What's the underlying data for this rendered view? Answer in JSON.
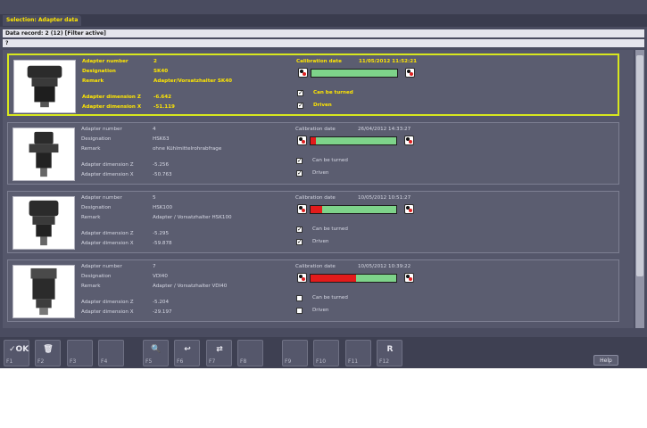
{
  "header": {
    "tab_label": "Selection: Adapter data",
    "record_info": "Data record: 2 (12) [Filter active]",
    "filter_text": "?"
  },
  "labels": {
    "adapter_number": "Adapter number",
    "designation": "Designation",
    "remark": "Remark",
    "dim_z": "Adapter dimension Z",
    "dim_x": "Adapter dimension X",
    "calibration_date": "Calibration date",
    "can_be_turned": "Can be turned",
    "driven": "Driven"
  },
  "records": [
    {
      "number": "2",
      "designation": "SK40",
      "remark": "Adapter/Vorsatzhalter SK40",
      "dim_z": "-6.642",
      "dim_x": "-51.119",
      "calibration_date": "11/05/2012 11:52:21",
      "wear_fraction": 0.0,
      "can_be_turned": true,
      "driven": true,
      "selected": true
    },
    {
      "number": "4",
      "designation": "HSK63",
      "remark": "ohne Kühlmittelrohrabfrage",
      "dim_z": "-5.256",
      "dim_x": "-50.763",
      "calibration_date": "26/04/2012 14:33:27",
      "wear_fraction": 0.06,
      "can_be_turned": true,
      "driven": true,
      "selected": false
    },
    {
      "number": "5",
      "designation": "HSK100",
      "remark": "Adapter / Vorsatzhalter HSK100",
      "dim_z": "-5.295",
      "dim_x": "-59.878",
      "calibration_date": "10/05/2012 10:51:27",
      "wear_fraction": 0.14,
      "can_be_turned": true,
      "driven": true,
      "selected": false
    },
    {
      "number": "7",
      "designation": "VDI40",
      "remark": "Adapter / Vorsatzhalter VDI40",
      "dim_z": "-5.204",
      "dim_x": "-29.197",
      "calibration_date": "10/05/2012 10:39:22",
      "wear_fraction": 0.53,
      "can_be_turned": false,
      "driven": false,
      "selected": false
    }
  ],
  "colors": {
    "accent": "#ffe600",
    "wear_ok": "#7ed38a",
    "wear_bad": "#e31b1b",
    "selection_border": "#d8e81e"
  },
  "function_keys": [
    {
      "label": "F1",
      "icon": "ok-check-icon",
      "glyph": "✓OK"
    },
    {
      "label": "F2",
      "icon": "trash-icon",
      "glyph": "🗑"
    },
    {
      "label": "F3",
      "icon": "",
      "glyph": ""
    },
    {
      "label": "F4",
      "icon": "",
      "glyph": ""
    },
    {
      "label": "F5",
      "icon": "search-icon",
      "glyph": "🔍"
    },
    {
      "label": "F6",
      "icon": "undo-list-icon",
      "glyph": "↩"
    },
    {
      "label": "F7",
      "icon": "transfer-icon",
      "glyph": "⇄"
    },
    {
      "label": "F8",
      "icon": "",
      "glyph": ""
    },
    {
      "label": "F9",
      "icon": "",
      "glyph": ""
    },
    {
      "label": "F10",
      "icon": "",
      "glyph": ""
    },
    {
      "label": "F11",
      "icon": "",
      "glyph": ""
    },
    {
      "label": "F12",
      "icon": "return-icon",
      "glyph": "R"
    }
  ],
  "help_label": "Help"
}
